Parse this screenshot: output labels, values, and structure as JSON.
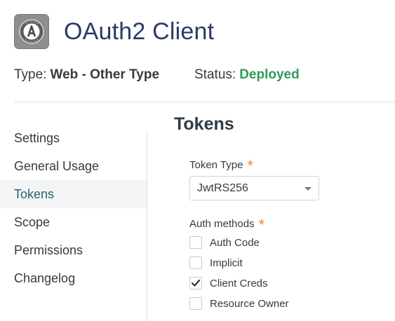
{
  "app": {
    "logo_icon": "app-logo-icon",
    "title": "OAuth2 Client"
  },
  "meta": {
    "type_label": "Type:",
    "type_value": "Web - Other Type",
    "status_label": "Status:",
    "status_value": "Deployed",
    "status_color": "#2e9a5a"
  },
  "sidebar": {
    "items": [
      {
        "label": "Settings",
        "active": false
      },
      {
        "label": "General Usage",
        "active": false
      },
      {
        "label": "Tokens",
        "active": true
      },
      {
        "label": "Scope",
        "active": false
      },
      {
        "label": "Permissions",
        "active": false
      },
      {
        "label": "Changelog",
        "active": false
      }
    ]
  },
  "main": {
    "section_title": "Tokens",
    "token_type": {
      "label": "Token Type",
      "required_mark": "*",
      "selected": "JwtRS256"
    },
    "auth_methods": {
      "label": "Auth methods",
      "required_mark": "*",
      "options": [
        {
          "label": "Auth Code",
          "checked": false
        },
        {
          "label": "Implicit",
          "checked": false
        },
        {
          "label": "Client Creds",
          "checked": true
        },
        {
          "label": "Resource Owner",
          "checked": false
        }
      ]
    }
  },
  "colors": {
    "title": "#2c3a66",
    "accent_required": "#f0843a",
    "active_sidebar_text": "#2a6170"
  }
}
